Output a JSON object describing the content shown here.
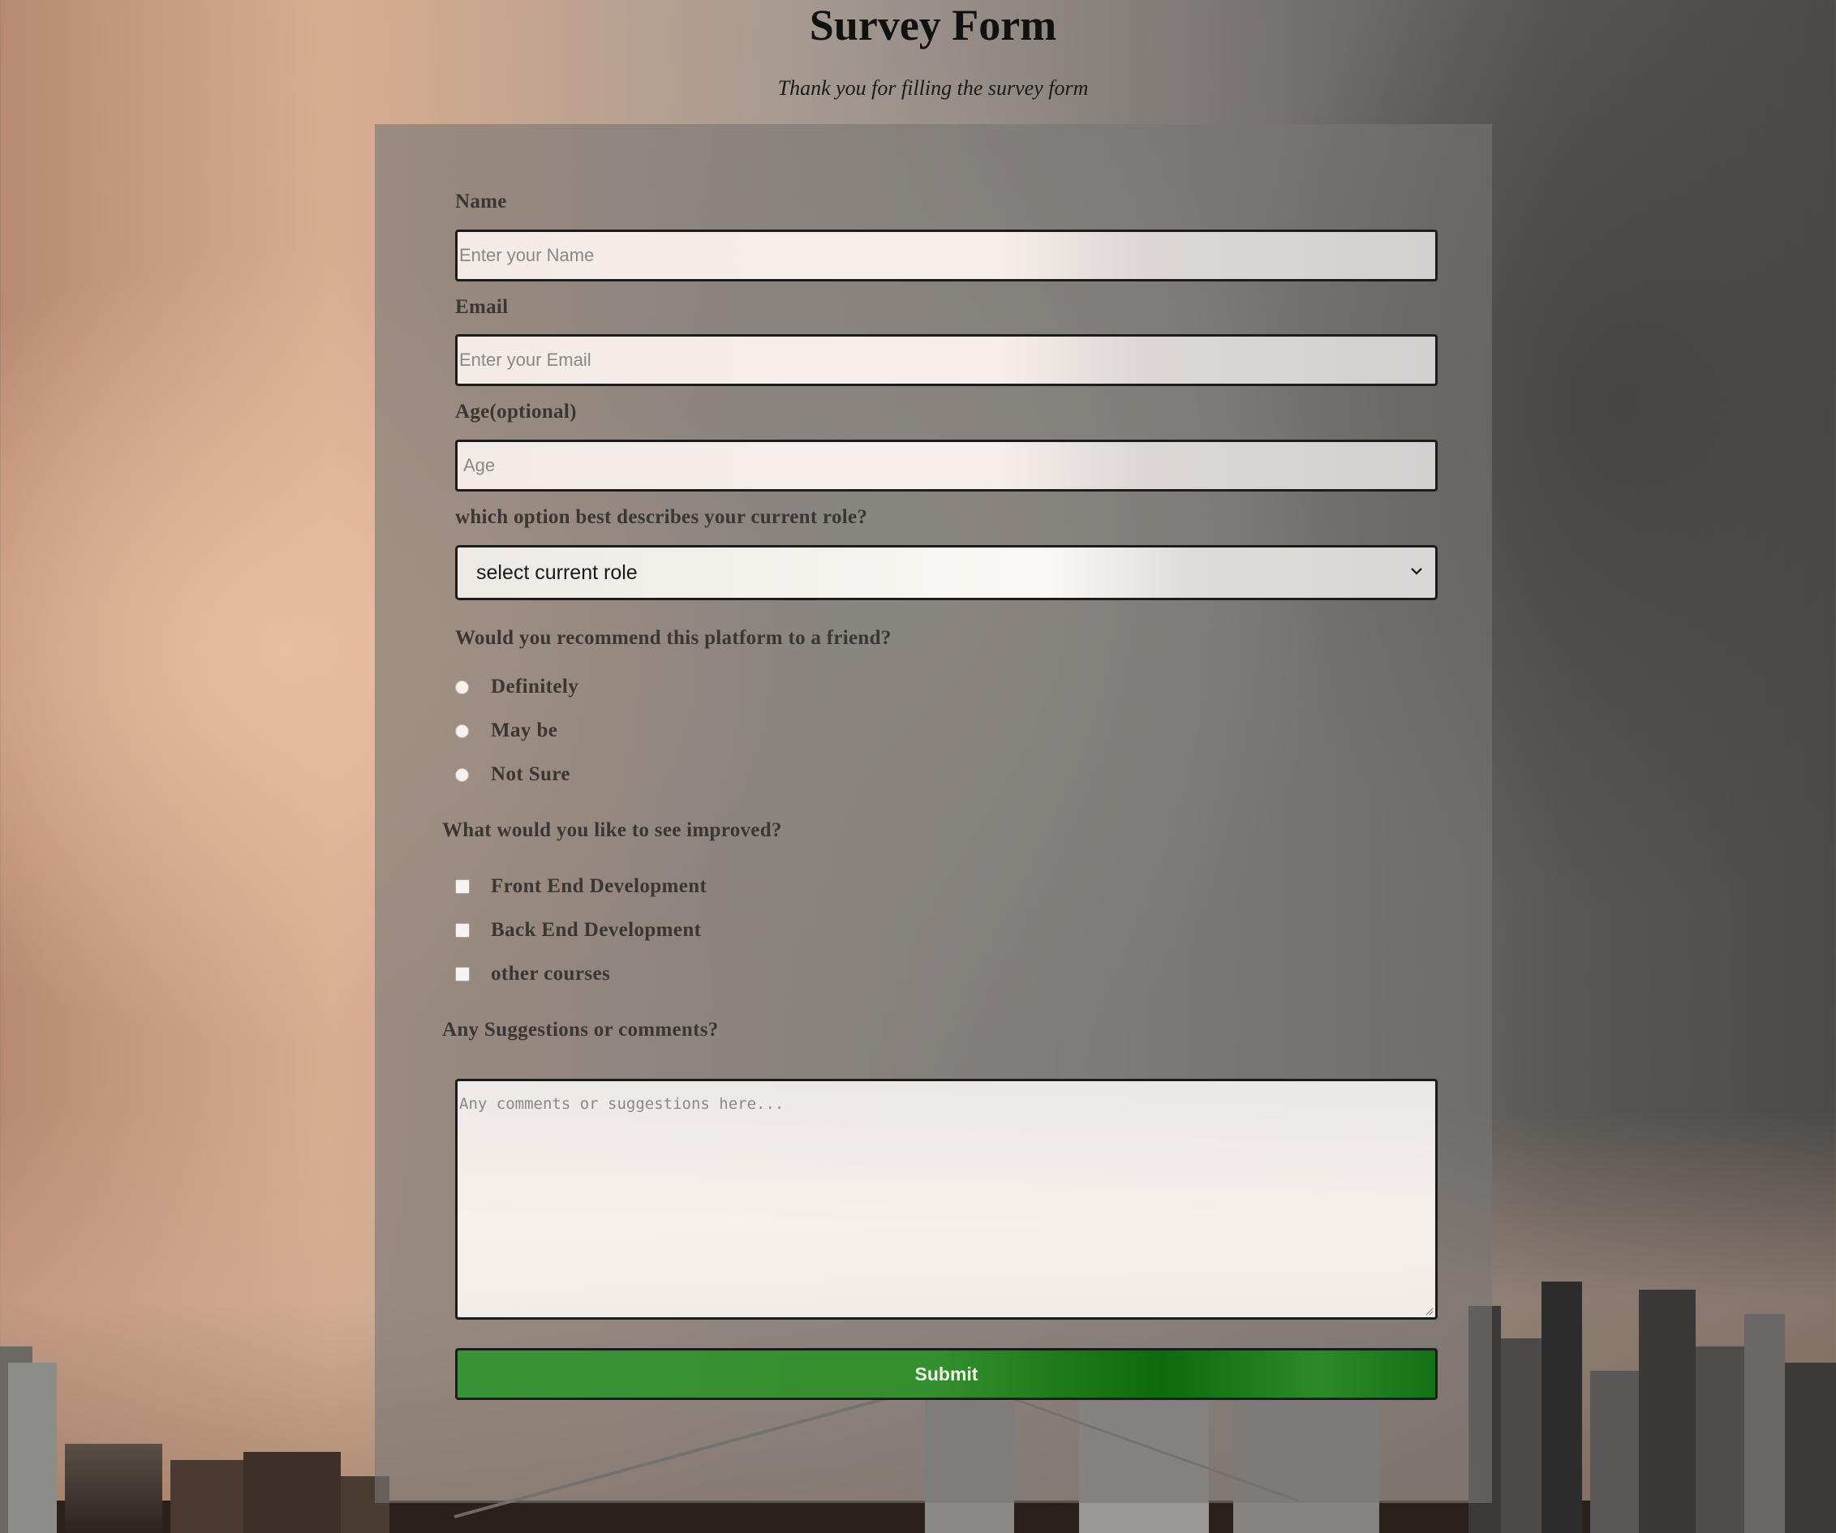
{
  "header": {
    "title": "Survey Form",
    "description": "Thank you for filling the survey form"
  },
  "form": {
    "name": {
      "label": "Name",
      "placeholder": "Enter your Name"
    },
    "email": {
      "label": "Email",
      "placeholder": "Enter your Email"
    },
    "age": {
      "label": "Age(optional)",
      "placeholder": "Age"
    },
    "role": {
      "label": "which option best describes your current role?",
      "selected": "select current role"
    },
    "recommend": {
      "label": "Would you recommend this platform to a friend?",
      "options": [
        "Definitely",
        "May be",
        "Not Sure"
      ]
    },
    "improve": {
      "label": "What would you like to see improved?",
      "options": [
        "Front End Development",
        "Back End Development",
        "other courses"
      ]
    },
    "comments": {
      "label": "Any Suggestions or comments?",
      "placeholder": "Any comments or suggestions here..."
    },
    "submit_label": "Submit"
  },
  "colors": {
    "submit_green": "#35902f",
    "card_overlay": "#787674",
    "border": "#1c1c1c"
  },
  "icons": {
    "select_arrow": "chevron-down-icon",
    "textarea_resize": "resize-handle-icon"
  }
}
